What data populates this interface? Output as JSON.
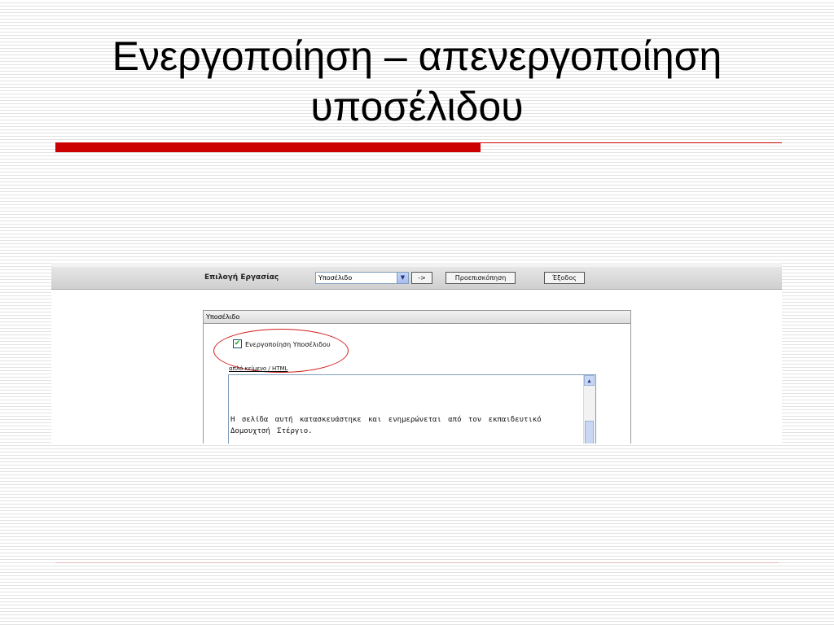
{
  "slide": {
    "title_line1": "Ενεργοποίηση – απενεργοποίηση",
    "title_line2": "υποσέλιδου"
  },
  "toolbar": {
    "task_label": "Επιλογή Εργασίας",
    "task_select_value": "Υποσέλιδο",
    "go_button": "->",
    "preview_button": "Προεπισκόπηση",
    "exit_button": "Έξοδος"
  },
  "panel": {
    "header": "Υποσέλιδο",
    "enable_checkbox": {
      "label": "Ενεργοποίηση Υποσέλιδου",
      "checked": true
    },
    "mode_label": "απλό κείμενο / HTML",
    "text_content": "Η σελίδα αυτή κατασκευάστηκε και ενημερώνεται από τον εκπαιδευτικό Δομουχτσή Στέργιο."
  },
  "colors": {
    "accent_red": "#cc0000",
    "highlight_ellipse": "#d11c1c",
    "checkmark_green": "#21a121"
  },
  "icons": [
    "checkmark-icon",
    "dropdown-arrow-icon",
    "scroll-up-arrow-icon"
  ]
}
